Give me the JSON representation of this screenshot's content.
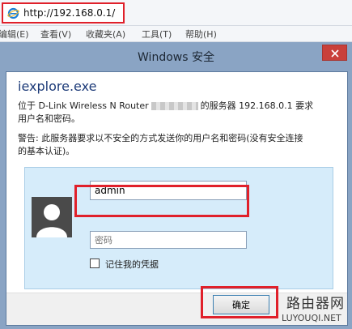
{
  "browser": {
    "url": "http://192.168.0.1/",
    "menu": [
      "编辑(E)",
      "查看(V)",
      "收藏夹(A)",
      "工具(T)",
      "帮助(H)"
    ]
  },
  "dialog": {
    "title": "Windows 安全",
    "app_name": "iexplore.exe",
    "server_line1_prefix": "位于 D-Link Wireless N Router",
    "server_line1_suffix": "的服务器 192.168.0.1 要求",
    "server_line2": "用户名和密码。",
    "warning_line1": "警告: 此服务器要求以不安全的方式发送你的用户名和密码(没有安全连接",
    "warning_line2": "的基本认证)。",
    "username_value": "admin",
    "password_placeholder": "密码",
    "remember_label": "记住我的凭据",
    "remember_checked": false,
    "ok_label": "确定"
  },
  "watermark": {
    "cn": "路由器网",
    "en": "LUYOUQI.NET"
  },
  "colors": {
    "highlight": "#e0202a",
    "dialog_frame": "#8aa4c4",
    "close_button": "#c9403a",
    "credential_panel": "#d6ecfa"
  }
}
